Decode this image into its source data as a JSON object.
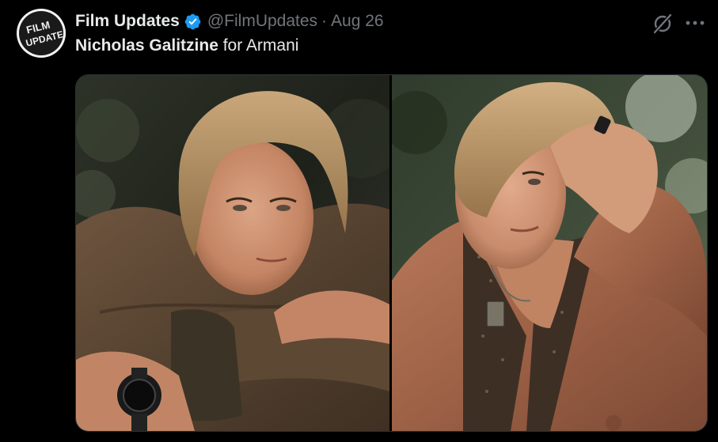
{
  "tweet": {
    "avatar_text_line1": "FILM",
    "avatar_text_line2": "UPDATES",
    "display_name": "Film Updates",
    "handle": "@FilmUpdates",
    "separator": "·",
    "date": "Aug 26",
    "text_bold": "Nicholas Galitzine",
    "text_rest": " for Armani",
    "verified_color": "#1d9bf0",
    "icons": {
      "verified": "verified-badge-icon",
      "grok": "grok-icon",
      "more": "more-options-icon"
    }
  },
  "media": {
    "photos": [
      {
        "label": "photo-1"
      },
      {
        "label": "photo-2"
      }
    ]
  }
}
